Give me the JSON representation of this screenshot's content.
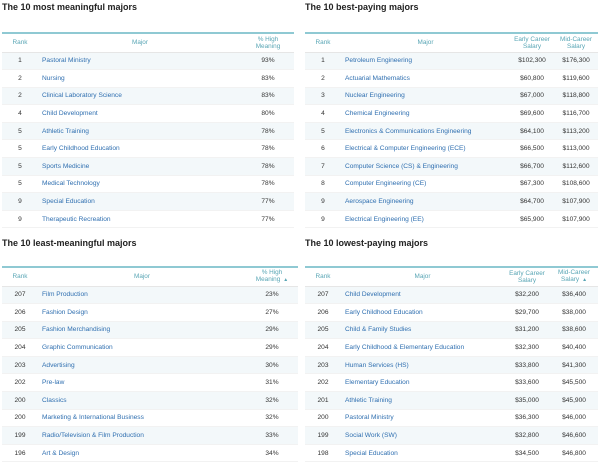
{
  "meaningful": {
    "title": "The 10 most meaningful majors",
    "headers": {
      "rank": "Rank",
      "major": "Major",
      "metric_line1": "% High",
      "metric_line2": "Meaning"
    },
    "rows": [
      {
        "rank": "1",
        "major": "Pastoral Ministry",
        "metric": "93%"
      },
      {
        "rank": "2",
        "major": "Nursing",
        "metric": "83%"
      },
      {
        "rank": "2",
        "major": "Clinical Laboratory Science",
        "metric": "83%"
      },
      {
        "rank": "4",
        "major": "Child Development",
        "metric": "80%"
      },
      {
        "rank": "5",
        "major": "Athletic Training",
        "metric": "78%"
      },
      {
        "rank": "5",
        "major": "Early Childhood Education",
        "metric": "78%"
      },
      {
        "rank": "5",
        "major": "Sports Medicine",
        "metric": "78%"
      },
      {
        "rank": "5",
        "major": "Medical Technology",
        "metric": "78%"
      },
      {
        "rank": "9",
        "major": "Special Education",
        "metric": "77%"
      },
      {
        "rank": "9",
        "major": "Therapeutic Recreation",
        "metric": "77%"
      }
    ]
  },
  "best_paying": {
    "title": "The 10 best-paying majors",
    "headers": {
      "rank": "Rank",
      "major": "Major",
      "early_line1": "Early Career",
      "early_line2": "Salary",
      "mid_line1": "Mid-Career",
      "mid_line2": "Salary"
    },
    "rows": [
      {
        "rank": "1",
        "major": "Petroleum Engineering",
        "early": "$102,300",
        "mid": "$176,300"
      },
      {
        "rank": "2",
        "major": "Actuarial Mathematics",
        "early": "$60,800",
        "mid": "$119,600"
      },
      {
        "rank": "3",
        "major": "Nuclear Engineering",
        "early": "$67,000",
        "mid": "$118,800"
      },
      {
        "rank": "4",
        "major": "Chemical Engineering",
        "early": "$69,600",
        "mid": "$116,700"
      },
      {
        "rank": "5",
        "major": "Electronics & Communications Engineering",
        "early": "$64,100",
        "mid": "$113,200"
      },
      {
        "rank": "6",
        "major": "Electrical & Computer Engineering (ECE)",
        "early": "$66,500",
        "mid": "$113,000"
      },
      {
        "rank": "7",
        "major": "Computer Science (CS) & Engineering",
        "early": "$66,700",
        "mid": "$112,600"
      },
      {
        "rank": "8",
        "major": "Computer Engineering (CE)",
        "early": "$67,300",
        "mid": "$108,600"
      },
      {
        "rank": "9",
        "major": "Aerospace Engineering",
        "early": "$64,700",
        "mid": "$107,900"
      },
      {
        "rank": "9",
        "major": "Electrical Engineering (EE)",
        "early": "$65,900",
        "mid": "$107,900"
      }
    ]
  },
  "least_meaningful": {
    "title": "The 10 least-meaningful majors",
    "headers": {
      "rank": "Rank",
      "major": "Major",
      "metric_line1": "% High",
      "metric_line2": "Meaning"
    },
    "rows": [
      {
        "rank": "207",
        "major": "Film Production",
        "metric": "23%"
      },
      {
        "rank": "206",
        "major": "Fashion Design",
        "metric": "27%"
      },
      {
        "rank": "205",
        "major": "Fashion Merchandising",
        "metric": "29%"
      },
      {
        "rank": "204",
        "major": "Graphic Communication",
        "metric": "29%"
      },
      {
        "rank": "203",
        "major": "Advertising",
        "metric": "30%"
      },
      {
        "rank": "202",
        "major": "Pre-law",
        "metric": "31%"
      },
      {
        "rank": "200",
        "major": "Classics",
        "metric": "32%"
      },
      {
        "rank": "200",
        "major": "Marketing & International Business",
        "metric": "32%"
      },
      {
        "rank": "199",
        "major": "Radio/Television & Film Production",
        "metric": "33%"
      },
      {
        "rank": "196",
        "major": "Art & Design",
        "metric": "34%"
      }
    ]
  },
  "lowest_paying": {
    "title": "The 10 lowest-paying majors",
    "headers": {
      "rank": "Rank",
      "major": "Major",
      "early_line1": "Early Career",
      "early_line2": "Salary",
      "mid_line1": "Mid-Career",
      "mid_line2": "Salary"
    },
    "rows": [
      {
        "rank": "207",
        "major": "Child Development",
        "early": "$32,200",
        "mid": "$36,400"
      },
      {
        "rank": "206",
        "major": "Early Childhood Education",
        "early": "$29,700",
        "mid": "$38,000"
      },
      {
        "rank": "205",
        "major": "Child & Family Studies",
        "early": "$31,200",
        "mid": "$38,600"
      },
      {
        "rank": "204",
        "major": "Early Childhood & Elementary Education",
        "early": "$32,300",
        "mid": "$40,400"
      },
      {
        "rank": "203",
        "major": "Human Services (HS)",
        "early": "$33,800",
        "mid": "$41,300"
      },
      {
        "rank": "202",
        "major": "Elementary Education",
        "early": "$33,600",
        "mid": "$45,500"
      },
      {
        "rank": "201",
        "major": "Athletic Training",
        "early": "$35,000",
        "mid": "$45,900"
      },
      {
        "rank": "200",
        "major": "Pastoral Ministry",
        "early": "$36,300",
        "mid": "$46,000"
      },
      {
        "rank": "199",
        "major": "Social Work (SW)",
        "early": "$32,800",
        "mid": "$46,600"
      },
      {
        "rank": "198",
        "major": "Special Education",
        "early": "$34,500",
        "mid": "$46,800"
      }
    ]
  },
  "sort_glyph": "▲",
  "colors": {
    "header_text": "#59a6b5",
    "accent_rule": "#8fc9d3",
    "link_text": "#2f6fb0",
    "stripe": "#f3f8fa"
  }
}
